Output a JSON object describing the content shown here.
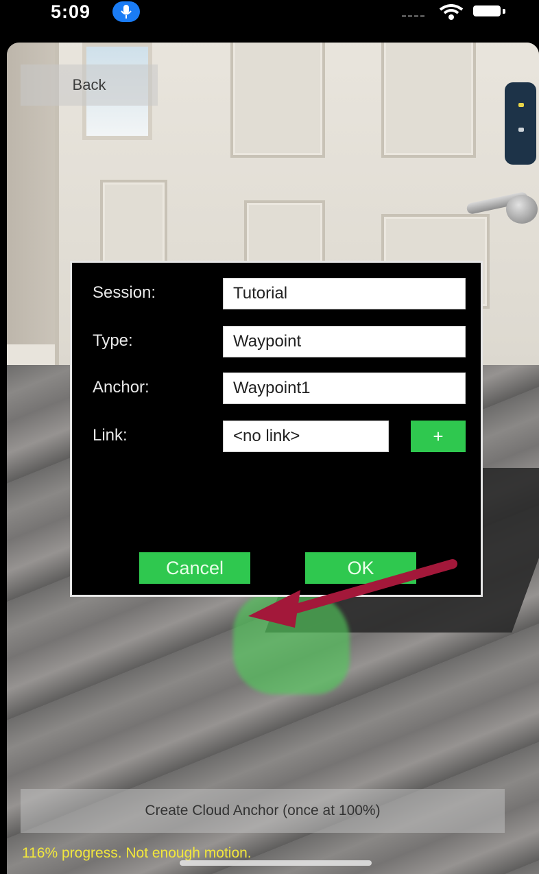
{
  "status_bar": {
    "time": "5:09",
    "icons": [
      "mic-icon",
      "signal-icon",
      "wifi-icon",
      "battery-icon"
    ]
  },
  "nav": {
    "back_label": "Back"
  },
  "dialog": {
    "session_label": "Session:",
    "session_value": "Tutorial",
    "type_label": "Type:",
    "type_value": "Waypoint",
    "anchor_label": "Anchor:",
    "anchor_value": "Waypoint1",
    "link_label": "Link:",
    "link_value": "<no link>",
    "add_link_label": "+",
    "cancel_label": "Cancel",
    "ok_label": "OK"
  },
  "bottom": {
    "create_button_label": "Create Cloud Anchor (once at 100%)",
    "progress_text": "116% progress. Not enough motion."
  },
  "colors": {
    "accent_green": "#2fc84f",
    "annotation_arrow": "#a3183a",
    "progress_text": "#f2e73c",
    "mic_blue": "#1a7cf5"
  }
}
